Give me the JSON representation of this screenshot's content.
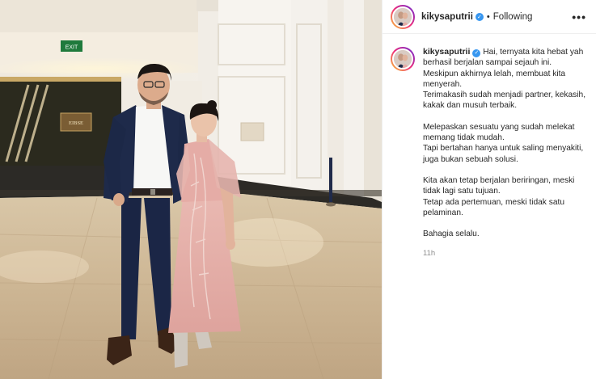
{
  "post": {
    "username": "kikysaputrii",
    "verified_icon": "verified-badge-icon",
    "follow_status": "Following",
    "more_icon": "more-options-icon",
    "more_label": "•••",
    "separator": "•",
    "caption_lines": [
      "Hai, ternyata kita hebat yah berhasil berjalan sampai sejauh ini. Meskipun akhirnya lelah, membuat kita menyerah.",
      "Terimakasih sudah menjadi partner, kekasih, kakak dan musuh terbaik."
    ],
    "caption_paragraphs": [
      "Melepaskan sesuatu yang sudah melekat memang tidak mudah.\nTapi bertahan hanya untuk saling menyakiti, juga bukan sebuah solusi.",
      "Kita akan tetap berjalan beriringan, meski tidak lagi satu tujuan.\nTetap ada pertemuan, meski tidak satu pelaminan.",
      "Bahagia selalu."
    ],
    "timestamp": "11h"
  },
  "photo": {
    "exit_sign": "EXIT",
    "venue_sign": "EIBSE",
    "colors": {
      "suit": "#1e2a4a",
      "dress": "#e8b4b0",
      "floor": "#cdbb9f",
      "wall": "#f3efe8",
      "exit_green": "#1f7a3c"
    }
  }
}
